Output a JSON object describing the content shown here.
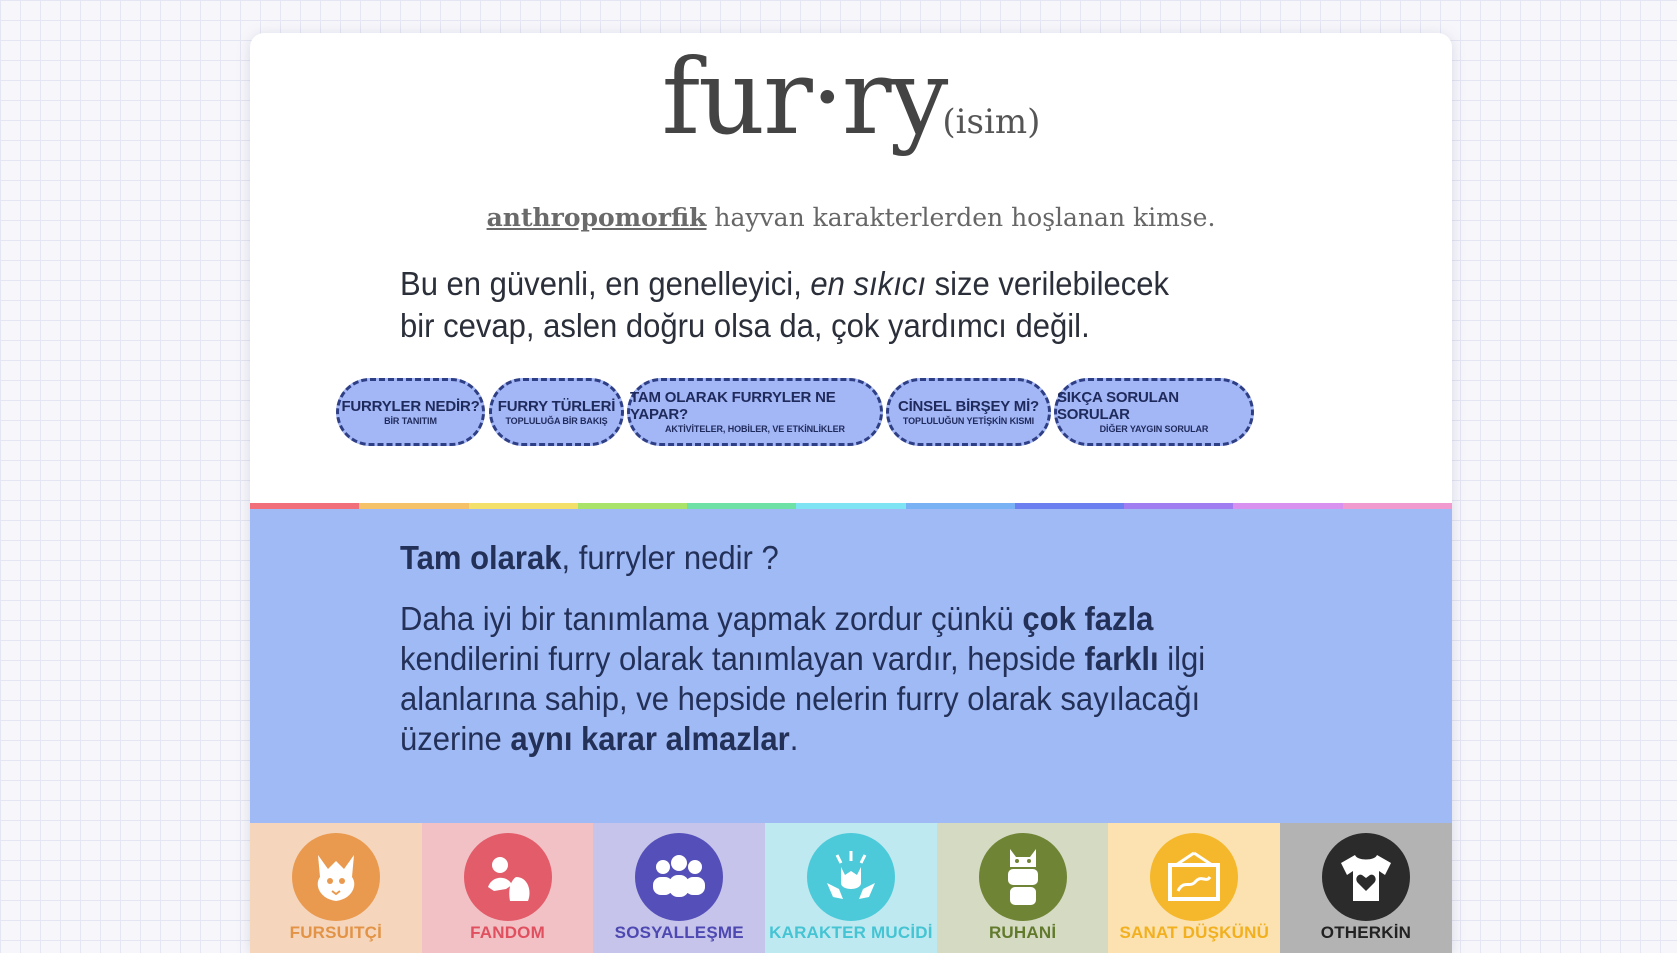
{
  "header": {
    "word": "fur·ry",
    "pos": "(isim)",
    "definition_link": "anthropomorfik",
    "definition_rest": "hayvan karakterlerden hoşlanan kimse."
  },
  "lead": {
    "part1": "Bu en güvenli, en genelleyici,",
    "emphasis": "en sıkıcı",
    "part2": "size verilebilecek bir cevap, aslen doğru olsa da, çok yardımcı değil."
  },
  "nav": [
    {
      "title": "FURRYLER NEDİR?",
      "sub": "BİR TANITIM"
    },
    {
      "title": "FURRY TÜRLERİ",
      "sub": "TOPLULUĞA BİR BAKIŞ"
    },
    {
      "title": "TAM OLARAK FURRYLER NE YAPAR?",
      "sub": "AKTİVİTELER, HOBİLER, VE ETKİNLİKLER"
    },
    {
      "title": "CİNSEL BİRŞEY Mİ?",
      "sub": "TOPLULUĞUN YETİŞKİN KISMI"
    },
    {
      "title": "SIKÇA SORULAN SORULAR",
      "sub": "DİĞER YAYGIN SORULAR"
    }
  ],
  "section": {
    "q_bold": "Tam olarak",
    "q_rest": ", furryler nedir ?",
    "p1": "Daha iyi bir tanımlama yapmak zordur çünkü",
    "b1": "çok fazla",
    "p2": "kendilerini furry olarak tanımlayan vardır, hepside",
    "b2": "farklı",
    "p3": "ilgi alanlarına sahip, ve hepside nelerin furry olarak sayılacağı üzerine",
    "b3": "aynı karar almazlar",
    "p4": "."
  },
  "rainbow_colors": [
    "#f06f7a",
    "#f5c26a",
    "#f3e06a",
    "#a9e36a",
    "#6ee1a7",
    "#7ee3f2",
    "#78b2f5",
    "#6b7ff0",
    "#a07ef2",
    "#d891ef",
    "#f09ad0"
  ],
  "tiles": [
    {
      "label": "FURSUITÇİ",
      "icon": "fursuit-head-icon",
      "bg": "#f5d6bd",
      "circle": "#e99a4f",
      "text": "#e29345"
    },
    {
      "label": "FANDOM",
      "icon": "fandom-characters-icon",
      "bg": "#f2c1c6",
      "circle": "#e35c6a",
      "text": "#e0505f"
    },
    {
      "label": "SOSYALLEŞME",
      "icon": "group-people-icon",
      "bg": "#c6c4ea",
      "circle": "#5550b9",
      "text": "#4d48b2"
    },
    {
      "label": "KARAKTER MUCİDİ",
      "icon": "character-creator-icon",
      "bg": "#bfe9f0",
      "circle": "#4ccad9",
      "text": "#45c4d4"
    },
    {
      "label": "RUHANİ",
      "icon": "totem-icon",
      "bg": "#d5dac3",
      "circle": "#6f8535",
      "text": "#627a2c"
    },
    {
      "label": "SANAT DÜŞKÜNÜ",
      "icon": "art-frame-icon",
      "bg": "#fbe2b0",
      "circle": "#f5b82c",
      "text": "#f2b01f"
    },
    {
      "label": "OTHERKİN",
      "icon": "heart-shirt-icon",
      "bg": "#b3b3b3",
      "circle": "#2b2b2b",
      "text": "#222222"
    }
  ]
}
